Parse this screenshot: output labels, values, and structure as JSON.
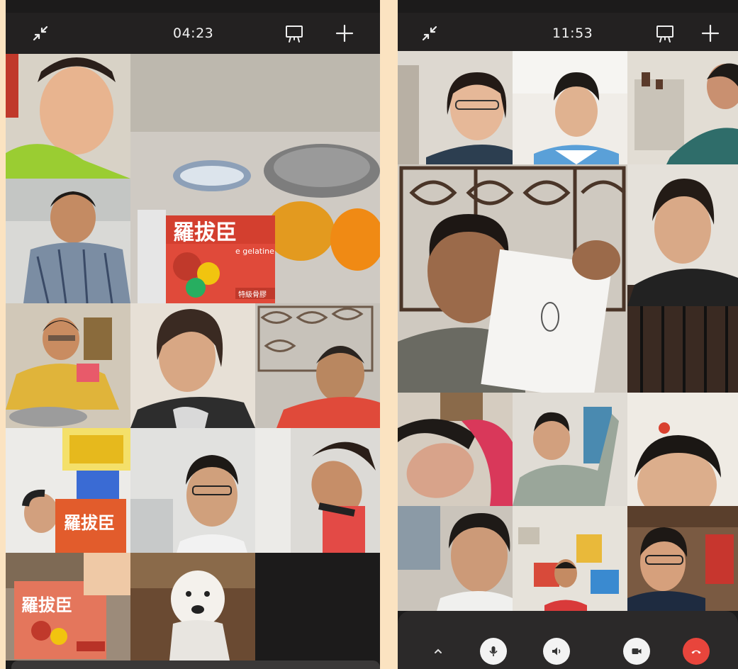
{
  "left_phone": {
    "call_timer": "04:23",
    "icons": [
      "minimize-icon",
      "whiteboard-icon",
      "add-participant-icon"
    ],
    "package_text": {
      "brand": "羅拔臣",
      "subtitle": "e gelatine",
      "tag": "特級骨膠"
    }
  },
  "right_phone": {
    "call_timer": "11:53",
    "icons": [
      "minimize-icon",
      "whiteboard-icon",
      "add-participant-icon"
    ],
    "controls": [
      {
        "name": "expand-controls",
        "icon": "chevron-up-icon"
      },
      {
        "name": "microphone",
        "icon": "microphone-icon"
      },
      {
        "name": "speaker",
        "icon": "speaker-icon"
      },
      {
        "name": "camera",
        "icon": "video-camera-icon"
      },
      {
        "name": "hang-up",
        "icon": "hang-up-icon",
        "color": "#e8453c"
      }
    ]
  },
  "colors": {
    "page_background": "#fbe3c1",
    "phone_background": "#1c1b1b",
    "hangup_red": "#e8453c"
  }
}
